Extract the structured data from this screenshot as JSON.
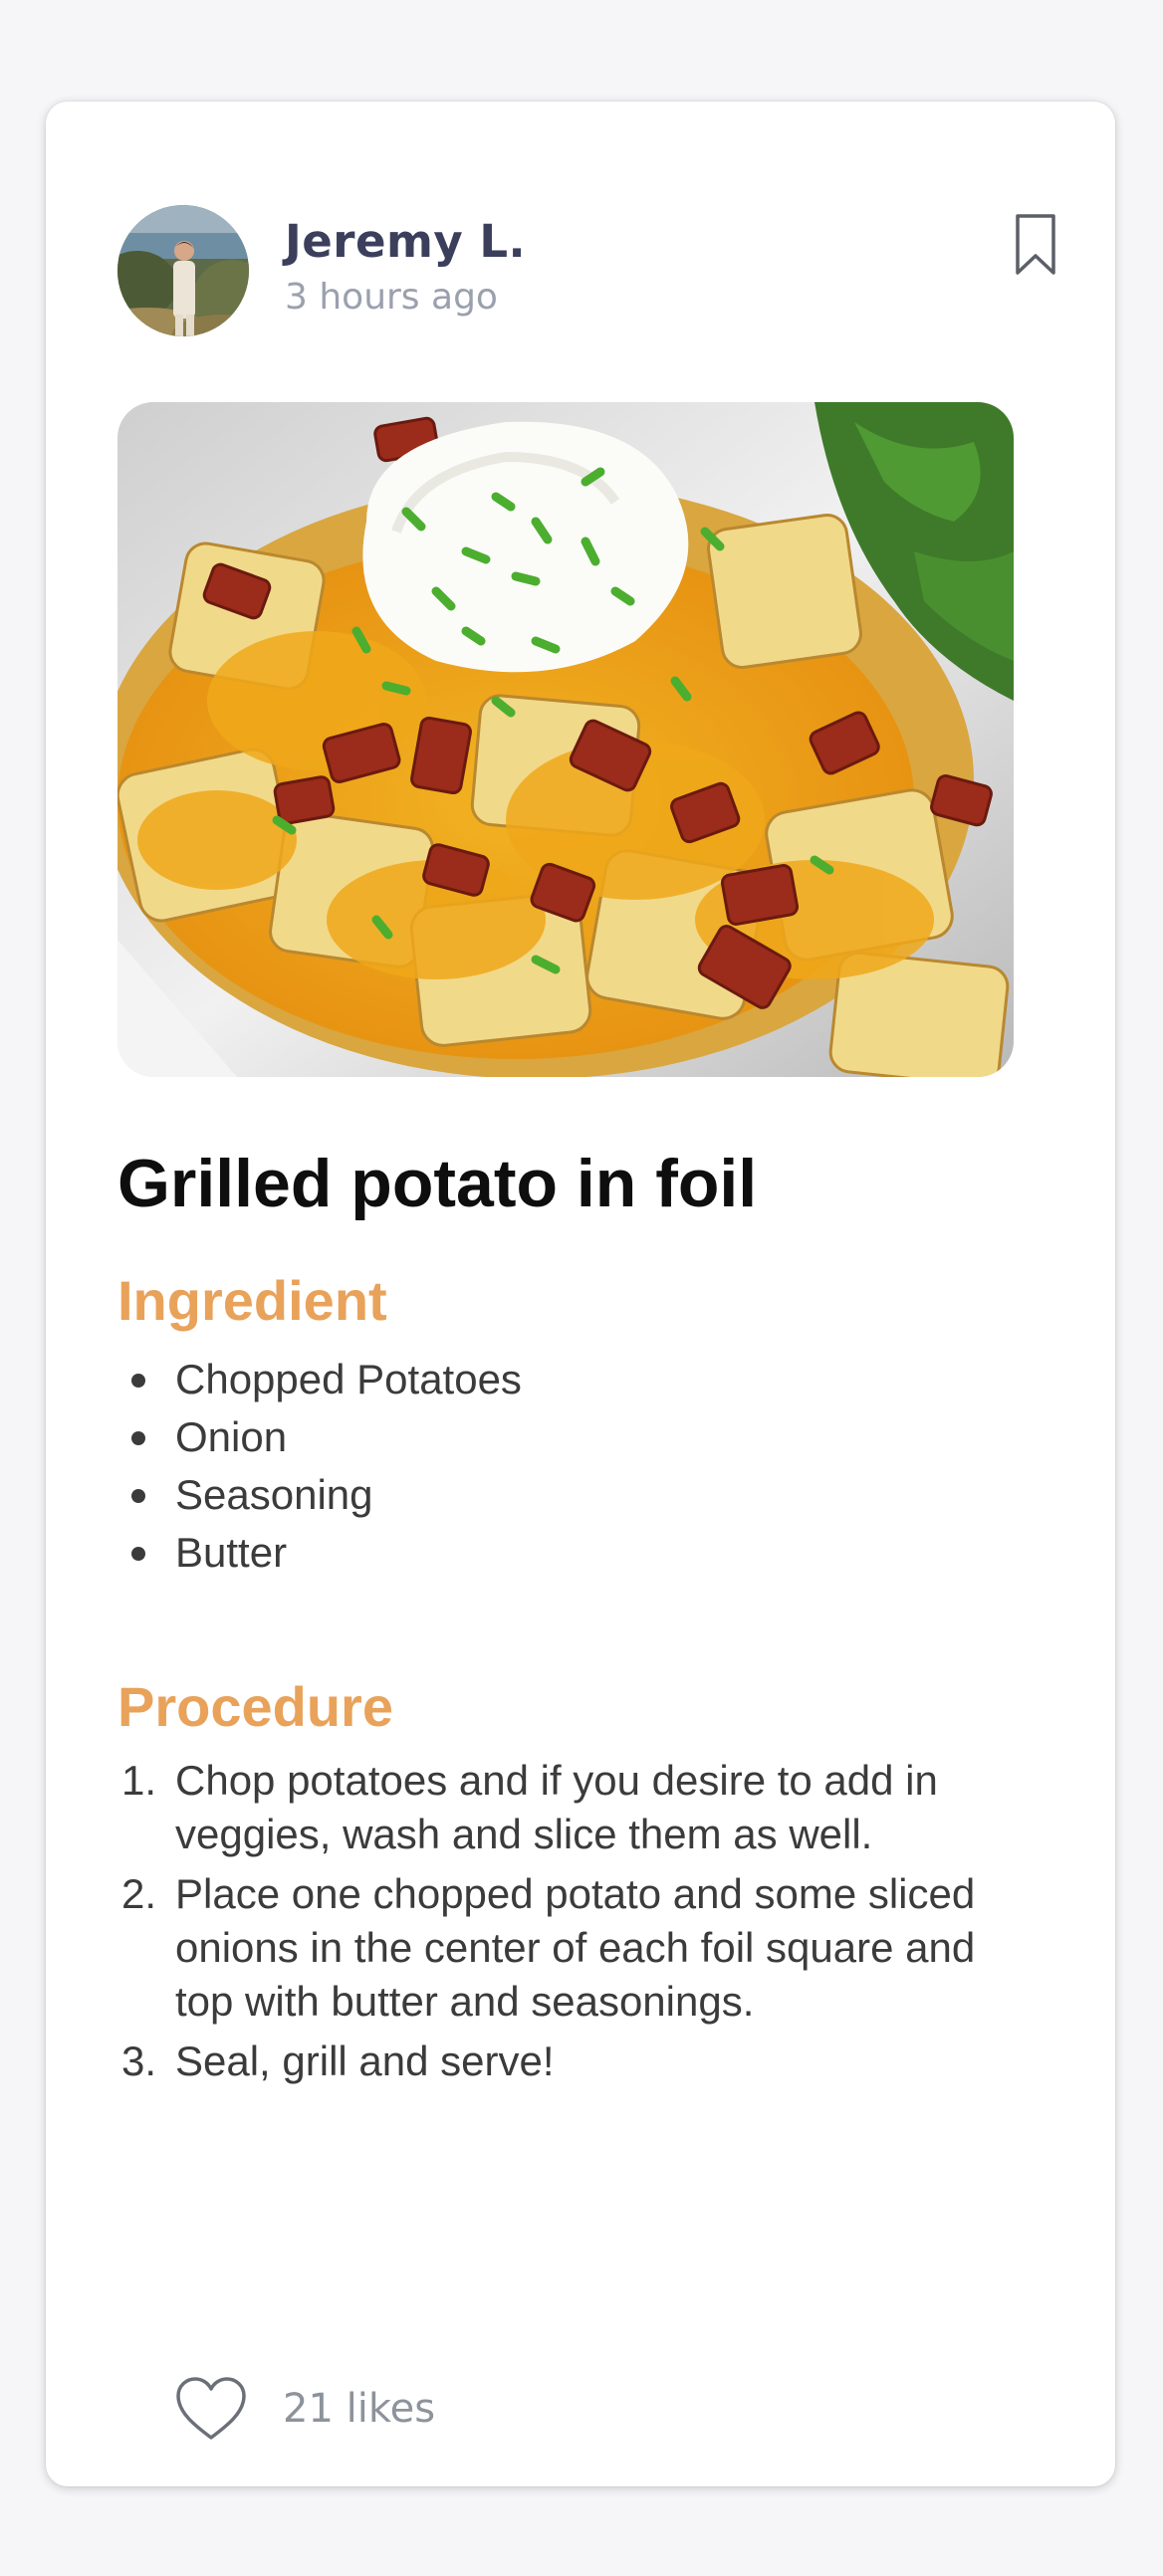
{
  "post": {
    "author": {
      "name": "Jeremy L.",
      "time": "3 hours ago"
    },
    "recipe": {
      "title": "Grilled potato in foil",
      "ingredient_heading": "Ingredient",
      "ingredients": [
        "Chopped Potatoes",
        "Onion",
        "Seasoning",
        "Butter"
      ],
      "procedure_heading": "Procedure",
      "steps": [
        {
          "num": "1.",
          "text": "Chop potatoes and if you desire to add in veggies, wash and slice them as well."
        },
        {
          "num": "2.",
          "text": "Place one chopped potato and some sliced onions in the center of each foil square and top with butter and seasonings."
        },
        {
          "num": "3.",
          "text": "Seal, grill and serve!"
        }
      ]
    },
    "likes": "21 likes"
  },
  "icons": {
    "bookmark": "bookmark-icon",
    "like": "heart-icon"
  },
  "colors": {
    "accent": "#e9a25a",
    "author_name": "#3b3f5c",
    "muted": "#9aa0ad"
  }
}
